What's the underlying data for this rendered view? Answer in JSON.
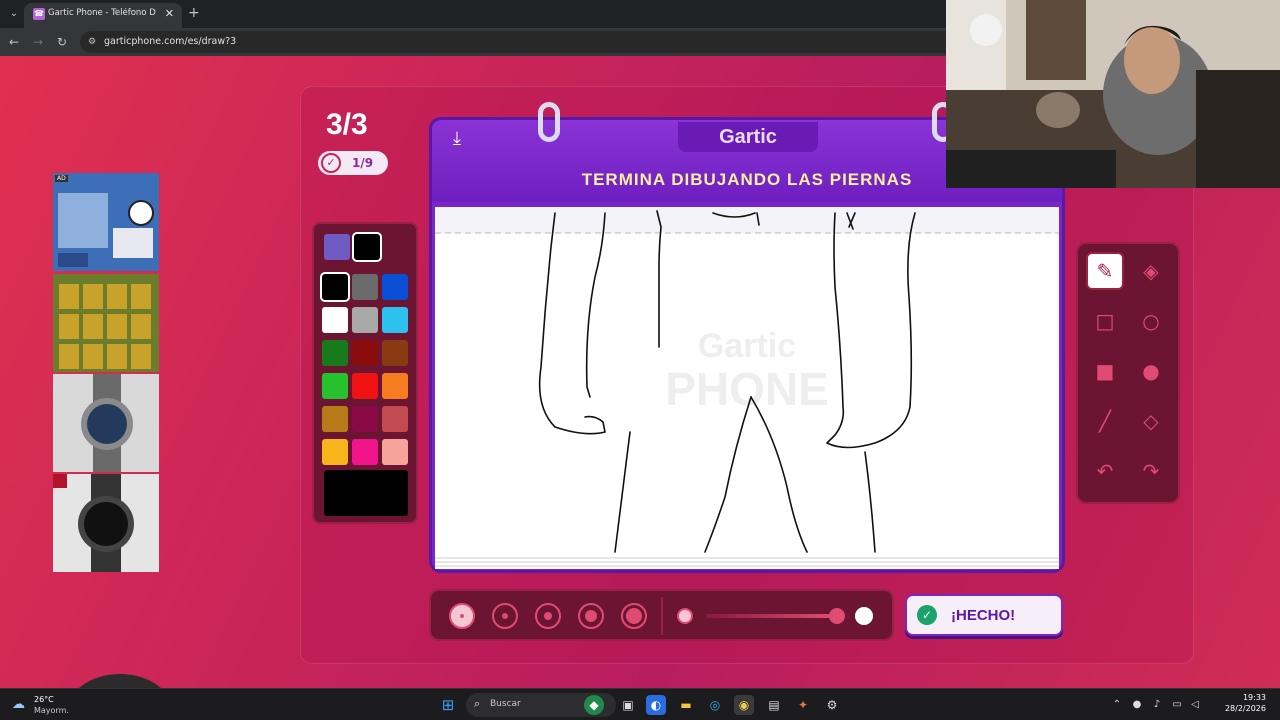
{
  "browser": {
    "tab_title": "Gartic Phone - Teléfono Descon",
    "tab_close": "✕",
    "new_tab": "+",
    "url": "garticphone.com/es/draw?3"
  },
  "game": {
    "round": "3/3",
    "progress": "1/9",
    "logo": "Gartic",
    "instruction": "TERMINA DIBUJANDO LAS PIERNAS",
    "watermark_top": "Gartic",
    "watermark_bottom": "PHONE",
    "done_label": "¡HECHO!",
    "palette": {
      "colors": [
        "#6e5cc4",
        "#000000",
        "#000000",
        "#6b6b6b",
        "#0a4fd6",
        "#ffffff",
        "#a9a9a9",
        "#2cc1ef",
        "#177a1b",
        "#8a0c0c",
        "#8a3a10",
        "#25c22e",
        "#f01212",
        "#f57c1f",
        "#b87a18",
        "#8a0a48",
        "#c24b52",
        "#f7b51b",
        "#f2148a",
        "#f7a39b"
      ],
      "current_color": "#000000"
    },
    "tools": [
      "pencil-icon",
      "eraser-icon",
      "square-outline-icon",
      "circle-outline-icon",
      "square-filled-icon",
      "circle-filled-icon",
      "line-icon",
      "fill-bucket-icon",
      "undo-icon",
      "redo-icon"
    ],
    "brush_sizes": 5,
    "selected_brush": 0
  },
  "taskbar": {
    "weather_temp": "26°C",
    "weather_desc": "Mayorm.",
    "search_placeholder": "Buscar",
    "time": "19:33",
    "date": "28/2/2026"
  }
}
